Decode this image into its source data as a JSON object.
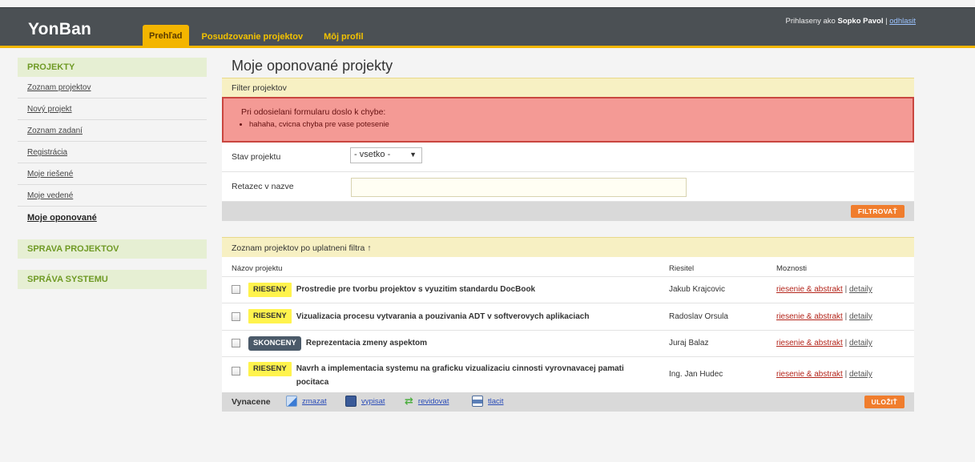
{
  "header": {
    "logo": "YonBan",
    "tabs": [
      {
        "label": "Prehľad",
        "active": true
      },
      {
        "label": "Posudzovanie projektov",
        "active": false
      },
      {
        "label": "Môj profil",
        "active": false
      }
    ],
    "user_prefix": "Prihlaseny ako",
    "user_name": "Sopko Pavol",
    "separator": "|",
    "logout": "odhlasit"
  },
  "sidebar": {
    "sections": [
      {
        "title": "PROJEKTY",
        "items": [
          "Zoznam projektov",
          "Nový projekt",
          "Zoznam zadaní",
          "Registrácia",
          "Moje riešené",
          "Moje vedené",
          "Moje oponované"
        ]
      },
      {
        "title": "SPRAVA PROJEKTOV",
        "items": []
      },
      {
        "title": "SPRÁVA SYSTEMU",
        "items": []
      }
    ],
    "current_item": "Moje oponované"
  },
  "main": {
    "title": "Moje oponované projekty",
    "filter_heading": "Filter projektov",
    "error": {
      "title": "Pri odosielani formularu doslo k chybe:",
      "items": [
        "hahaha, cvicna chyba pre vase potesenie"
      ]
    },
    "filter": {
      "status_label": "Stav projektu",
      "status_value": "- vsetko -",
      "name_label": "Retazec v nazve",
      "name_value": "",
      "button": "FILTROVAŤ"
    },
    "list_heading": "Zoznam projektov po uplatneni filtra ↑",
    "table": {
      "columns": [
        "Názov projektu",
        "Riesitel",
        "Moznosti"
      ],
      "rows": [
        {
          "status": "RIESENY",
          "status_style": "yellow",
          "name": "Prostredie pre tvorbu projektov s vyuzitim standardu DocBook",
          "solver": "Jakub Krajcovic"
        },
        {
          "status": "RIESENY",
          "status_style": "yellow",
          "name": "Vizualizacia procesu vytvarania a pouzivania ADT v softverovych aplikaciach",
          "solver": "Radoslav Orsula"
        },
        {
          "status": "SKONCENY",
          "status_style": "dark",
          "name": "Reprezentacia zmeny aspektom",
          "solver": "Juraj Balaz"
        },
        {
          "status": "RIESENY",
          "status_style": "yellow",
          "name": "Navrh a implementacia systemu na graficku vizualizaciu cinnosti vyrovnavacej pamati pocitaca",
          "solver": "Ing. Jan Hudec"
        }
      ],
      "option_link_1": "riesenie & abstrakt",
      "option_separator": "|",
      "option_link_2": "detaily"
    },
    "bottom": {
      "label": "Vynacene",
      "actions": [
        {
          "label": "zmazat",
          "icon": "delete-icon",
          "color": "#3a7bd5"
        },
        {
          "label": "vypisat",
          "icon": "export-icon",
          "color": "#3a5a98"
        },
        {
          "label": "revidovat",
          "icon": "recycle-icon",
          "color": "#4cae3f"
        },
        {
          "label": "tlacit",
          "icon": "printer-icon",
          "color": "#5b7fb8"
        }
      ],
      "save_button": "ULOŽIŤ"
    }
  },
  "colors": {
    "accent": "#f3b500",
    "header_bg": "#4b5054",
    "error_bg": "#f49a95",
    "button": "#f07d2d",
    "sidebar_head": "#6f9a25"
  }
}
